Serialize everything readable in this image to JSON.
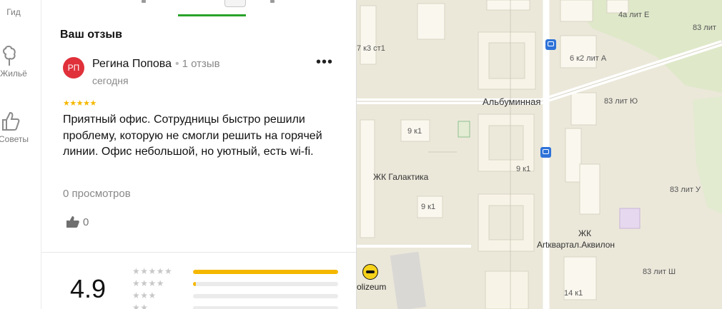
{
  "rail": {
    "items": [
      {
        "label": "Гид",
        "icon": "guide-icon"
      },
      {
        "label": "Жильё",
        "icon": "home-icon"
      },
      {
        "label": "Советы",
        "icon": "thumbs-up-icon"
      }
    ]
  },
  "review": {
    "section_title": "Ваш отзыв",
    "avatar_initials": "РП",
    "author_name": "Регина Попова",
    "author_reviews": "1 отзыв",
    "date": "сегодня",
    "stars": "★★★★★",
    "rating": 5,
    "text": "Приятный офис. Сотрудницы быстро решили проблему, которую не смогли решить на горячей линии. Офис небольшой, но уютный, есть wi-fi.",
    "views": "0 просмотров",
    "likes": "0",
    "more_label": "•••"
  },
  "rating_summary": {
    "value": "4.9",
    "rows": [
      {
        "stars": "★★★★★",
        "fill": 1.0
      },
      {
        "stars": "★★★★",
        "fill": 0.02
      },
      {
        "stars": "★★★",
        "fill": 0.0
      },
      {
        "stars": "★★",
        "fill": 0.0
      }
    ]
  },
  "map": {
    "streets": [
      {
        "name": "Альбуминная"
      }
    ],
    "poi": [
      {
        "name": "olizeum"
      }
    ],
    "labels": [
      "4а лит Е",
      "83 лит",
      "6 к2 лит А",
      "83 лит Ю",
      "9 к1",
      "9 к1",
      "9 к1",
      "ЖК Галактика",
      "83 лит У",
      "ЖК",
      "Artквартал.Аквилон",
      "83 лит Ш",
      "14 к1",
      "7 к3 ст1"
    ]
  },
  "colors": {
    "accent_green": "#29a329",
    "star": "#f5b800",
    "avatar": "#e0303a",
    "bus": "#2e72d8"
  }
}
